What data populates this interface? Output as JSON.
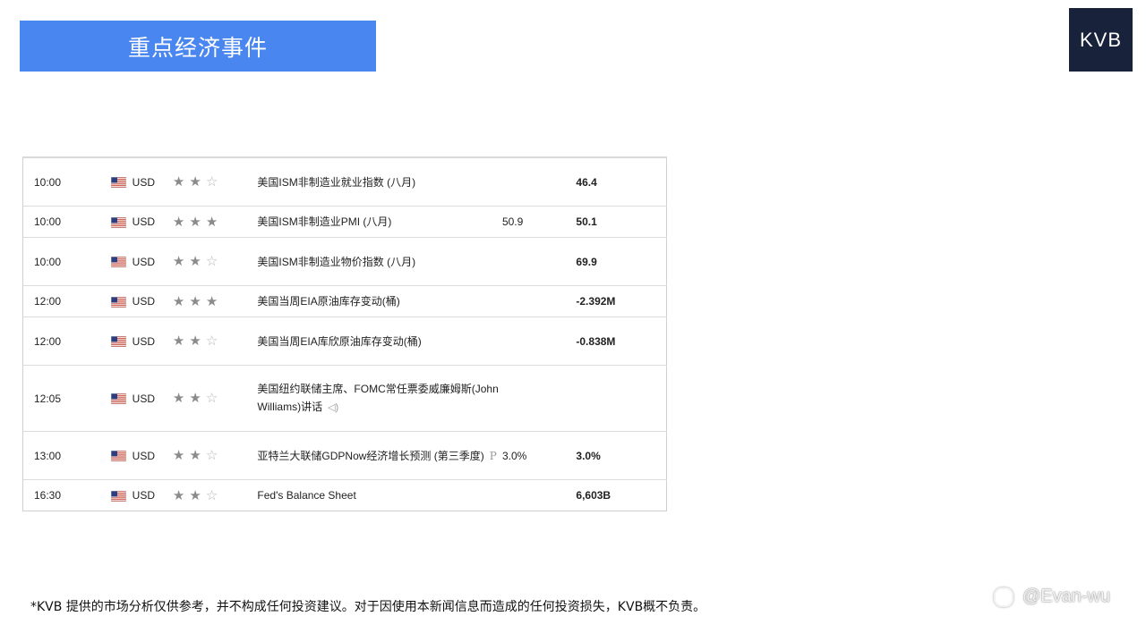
{
  "header": {
    "title": "重点经济事件",
    "logo_text": "KVB"
  },
  "events": [
    {
      "time": "10:00",
      "flag_icon": "us-flag-icon",
      "currency": "USD",
      "stars": 2,
      "event": "美国ISM非制造业就业指数 (八月)",
      "forecast": "",
      "actual": "46.4",
      "extra_icon": ""
    },
    {
      "time": "10:00",
      "flag_icon": "us-flag-icon",
      "currency": "USD",
      "stars": 3,
      "event": "美国ISM非制造业PMI (八月)",
      "forecast": "50.9",
      "actual": "50.1",
      "extra_icon": ""
    },
    {
      "time": "10:00",
      "flag_icon": "us-flag-icon",
      "currency": "USD",
      "stars": 2,
      "event": "美国ISM非制造业物价指数 (八月)",
      "forecast": "",
      "actual": "69.9",
      "extra_icon": ""
    },
    {
      "time": "12:00",
      "flag_icon": "us-flag-icon",
      "currency": "USD",
      "stars": 3,
      "event": "美国当周EIA原油库存变动(桶)",
      "forecast": "",
      "actual": "-2.392M",
      "extra_icon": ""
    },
    {
      "time": "12:00",
      "flag_icon": "us-flag-icon",
      "currency": "USD",
      "stars": 2,
      "event": "美国当周EIA库欣原油库存变动(桶)",
      "forecast": "",
      "actual": "-0.838M",
      "extra_icon": ""
    },
    {
      "time": "12:05",
      "flag_icon": "us-flag-icon",
      "currency": "USD",
      "stars": 2,
      "event": "美国纽约联储主席、FOMC常任票委威廉姆斯(John Williams)讲话",
      "forecast": "",
      "actual": "",
      "extra_icon": "speaker-icon"
    },
    {
      "time": "13:00",
      "flag_icon": "us-flag-icon",
      "currency": "USD",
      "stars": 2,
      "event": "亚特兰大联储GDPNow经济增长预测 (第三季度)",
      "forecast": "3.0%",
      "actual": "3.0%",
      "extra_icon": "preliminary-icon"
    },
    {
      "time": "16:30",
      "flag_icon": "us-flag-icon",
      "currency": "USD",
      "stars": 2,
      "event": "Fed's Balance Sheet",
      "forecast": "",
      "actual": "6,603B",
      "extra_icon": ""
    }
  ],
  "icons": {
    "speaker": "◁)",
    "preliminary": "P"
  },
  "disclaimer": "*KVB 提供的市场分析仅供参考，并不构成任何投资建议。对于因使用本新闻信息而造成的任何投资损失，KVB概不负责。",
  "watermark": "@Evan-wu",
  "colors": {
    "banner": "#4a86f0",
    "logo_bg": "#18223a"
  }
}
